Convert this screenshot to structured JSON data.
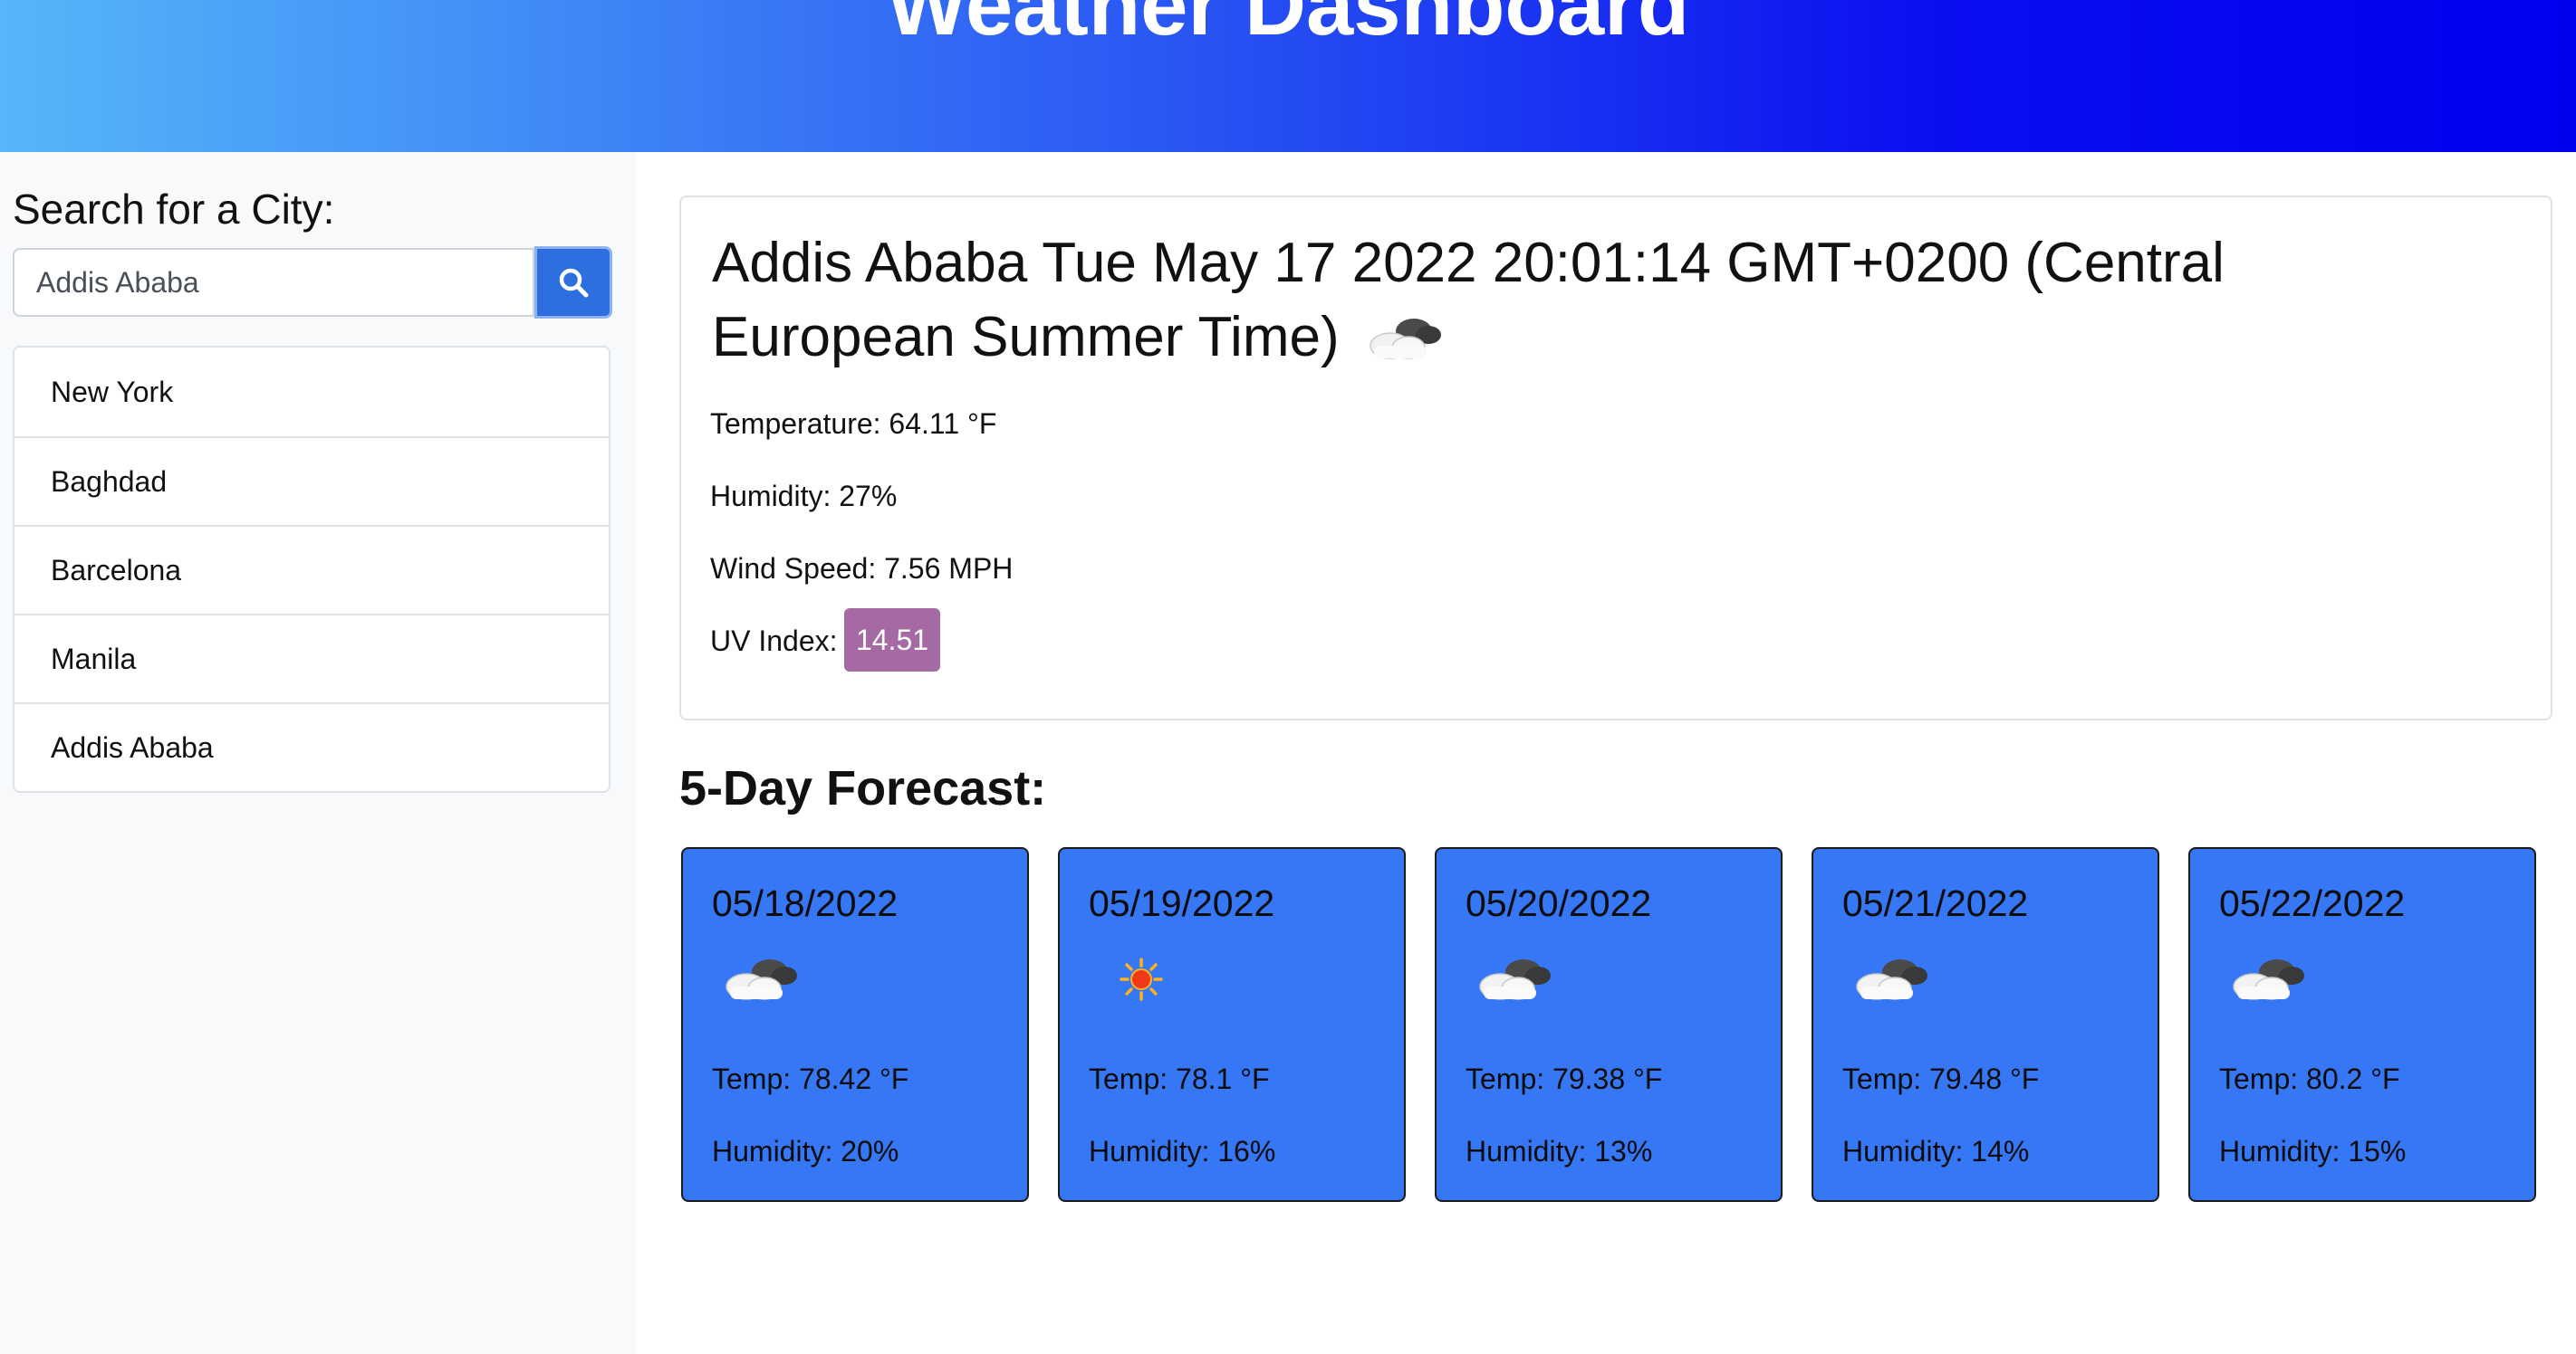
{
  "header": {
    "title": "Weather Dashboard"
  },
  "sidebar": {
    "search_title": "Search for a City:",
    "search_value": "Addis Ababa",
    "search_icon": "search-icon",
    "cities": [
      "New York",
      "Baghdad",
      "Barcelona",
      "Manila",
      "Addis Ababa"
    ]
  },
  "current": {
    "title": "Addis Ababa Tue May 17 2022 20:01:14 GMT+0200 (Central European Summer Time)",
    "icon": "cloudy-icon",
    "temperature": "Temperature: 64.11 °F",
    "humidity": "Humidity: 27%",
    "wind": "Wind Speed: 7.56 MPH",
    "uv_label": "UV Index:",
    "uv_value": "14.51",
    "uv_color": "#a56aa3"
  },
  "forecast": {
    "title": "5-Day Forecast:",
    "card_color": "#3577f4",
    "days": [
      {
        "date": "05/18/2022",
        "icon": "cloudy-icon",
        "temp": "Temp: 78.42 °F",
        "humidity": "Humidity: 20%"
      },
      {
        "date": "05/19/2022",
        "icon": "sun-icon",
        "temp": "Temp: 78.1 °F",
        "humidity": "Humidity: 16%"
      },
      {
        "date": "05/20/2022",
        "icon": "cloudy-icon",
        "temp": "Temp: 79.38 °F",
        "humidity": "Humidity: 13%"
      },
      {
        "date": "05/21/2022",
        "icon": "cloudy-icon",
        "temp": "Temp: 79.48 °F",
        "humidity": "Humidity: 14%"
      },
      {
        "date": "05/22/2022",
        "icon": "cloudy-icon",
        "temp": "Temp: 80.2 °F",
        "humidity": "Humidity: 15%"
      }
    ]
  }
}
